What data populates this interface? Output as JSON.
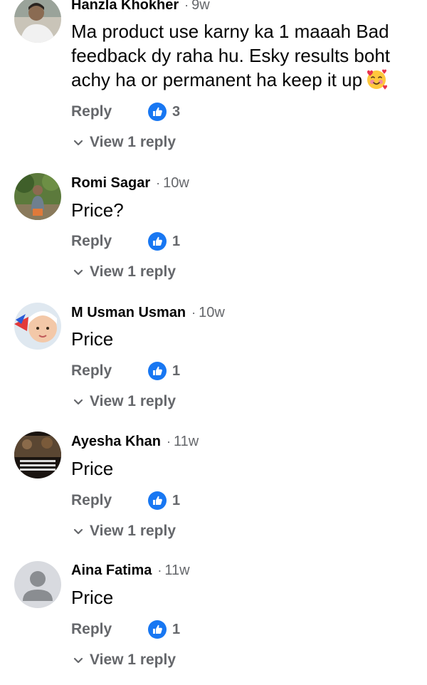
{
  "comments": [
    {
      "author": "Hanzla Khokher",
      "time": "9w",
      "text": "Ma product use karny ka 1 maaah Bad feedback dy raha hu. Esky results boht achy ha or permanent ha keep it up",
      "emoji_icon": "smiling-face-with-hearts-icon",
      "reply_label": "Reply",
      "likes": "3",
      "view_replies": "View 1 reply"
    },
    {
      "author": "Romi Sagar",
      "time": "10w",
      "text": "Price?",
      "reply_label": "Reply",
      "likes": "1",
      "view_replies": "View 1 reply"
    },
    {
      "author": "M Usman Usman",
      "time": "10w",
      "text": "Price",
      "reply_label": "Reply",
      "likes": "1",
      "view_replies": "View 1 reply"
    },
    {
      "author": "Ayesha Khan",
      "time": "11w",
      "text": "Price",
      "reply_label": "Reply",
      "likes": "1",
      "view_replies": "View 1 reply"
    },
    {
      "author": "Aina Fatima",
      "time": "11w",
      "text": "Price",
      "reply_label": "Reply",
      "likes": "1",
      "view_replies": "View 1 reply"
    }
  ],
  "colors": {
    "like_blue": "#1877f2",
    "secondary_text": "#65676b",
    "primary_text": "#050505"
  }
}
